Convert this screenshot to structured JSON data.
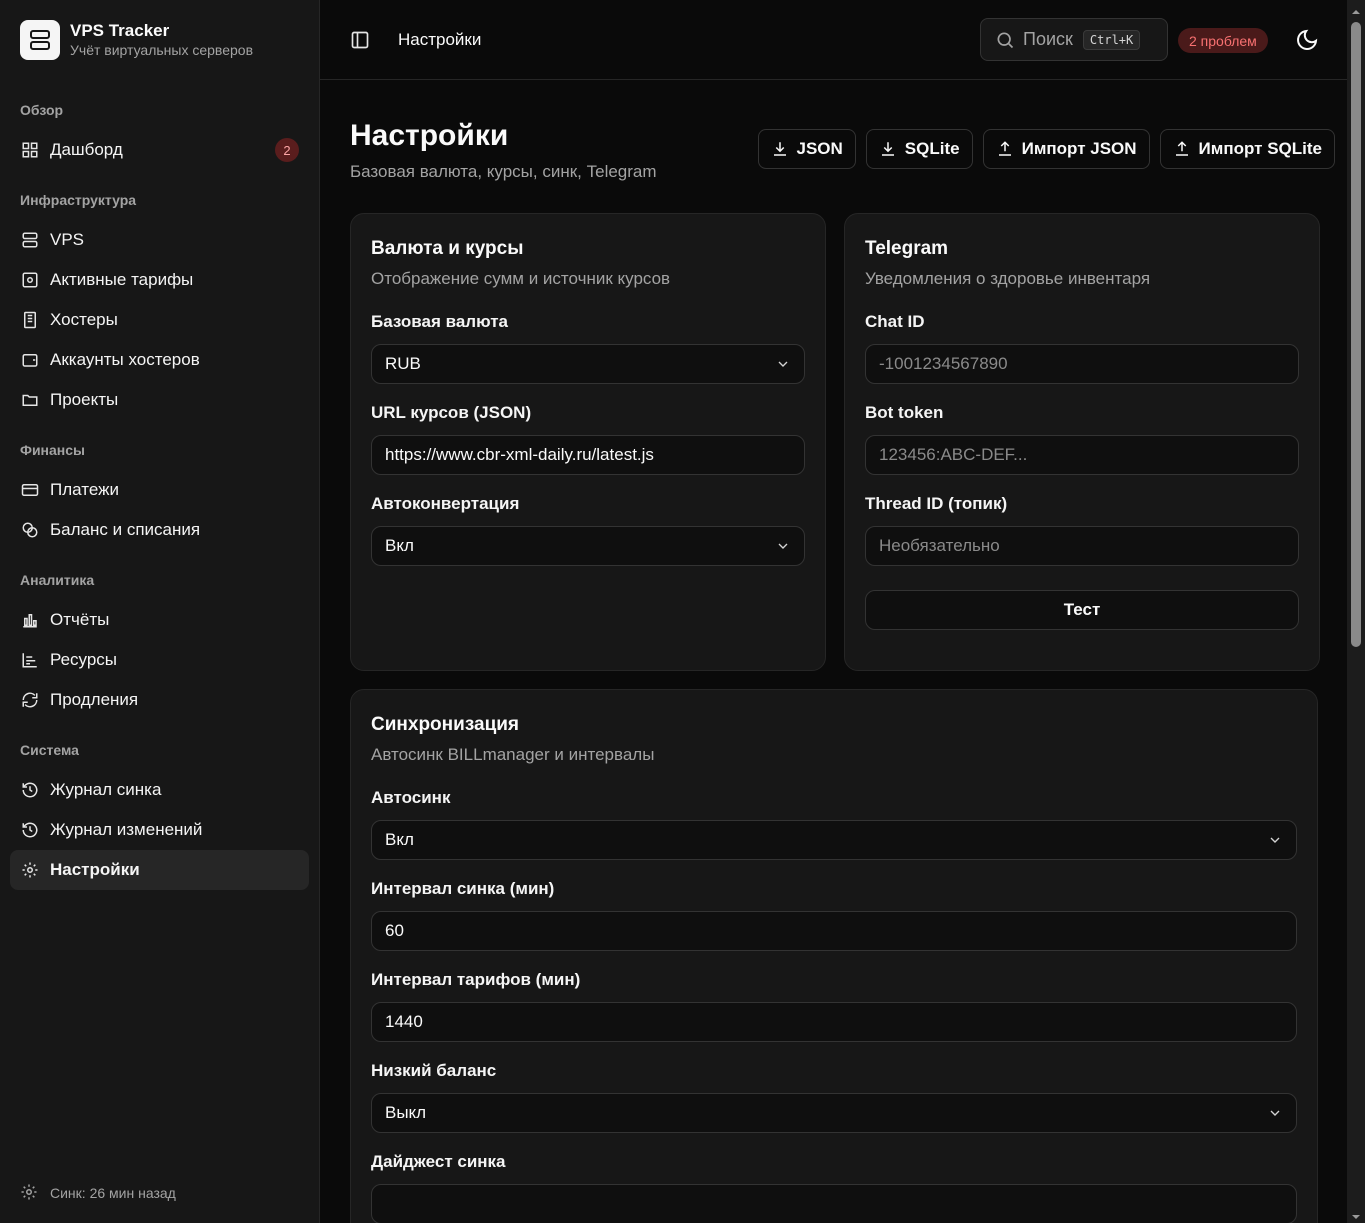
{
  "brand": {
    "title": "VPS Tracker",
    "subtitle": "Учёт виртуальных серверов"
  },
  "sidebar": {
    "groups": [
      {
        "label": "Обзор",
        "items": [
          {
            "label": "Дашборд",
            "badge": "2"
          }
        ]
      },
      {
        "label": "Инфраструктура",
        "items": [
          {
            "label": "VPS"
          },
          {
            "label": "Активные тарифы"
          },
          {
            "label": "Хостеры"
          },
          {
            "label": "Аккаунты хостеров"
          },
          {
            "label": "Проекты"
          }
        ]
      },
      {
        "label": "Финансы",
        "items": [
          {
            "label": "Платежи"
          },
          {
            "label": "Баланс и списания"
          }
        ]
      },
      {
        "label": "Аналитика",
        "items": [
          {
            "label": "Отчёты"
          },
          {
            "label": "Ресурсы"
          },
          {
            "label": "Продления"
          }
        ]
      },
      {
        "label": "Система",
        "items": [
          {
            "label": "Журнал синка"
          },
          {
            "label": "Журнал изменений"
          },
          {
            "label": "Настройки"
          }
        ]
      }
    ],
    "footer": "Синк: 26 мин назад"
  },
  "topbar": {
    "title": "Настройки",
    "search_placeholder": "Поиск",
    "shortcut": "Ctrl+K",
    "problems": "2 проблем"
  },
  "page": {
    "title": "Настройки",
    "subtitle": "Базовая валюта, курсы, синк, Telegram",
    "buttons": {
      "json": "JSON",
      "sqlite": "SQLite",
      "import_json": "Импорт JSON",
      "import_sqlite": "Импорт SQLite"
    }
  },
  "currency_card": {
    "title": "Валюта и курсы",
    "subtitle": "Отображение сумм и источник курсов",
    "base_label": "Базовая валюта",
    "base_value": "RUB",
    "url_label": "URL курсов (JSON)",
    "url_value": "https://www.cbr-xml-daily.ru/latest.js",
    "auto_label": "Автоконвертация",
    "auto_value": "Вкл"
  },
  "telegram_card": {
    "title": "Telegram",
    "subtitle": "Уведомления о здоровье инвентаря",
    "chat_label": "Chat ID",
    "chat_placeholder": "-1001234567890",
    "token_label": "Bot token",
    "token_placeholder": "123456:ABC-DEF...",
    "thread_label": "Thread ID (топик)",
    "thread_placeholder": "Необязательно",
    "test_label": "Тест"
  },
  "sync_card": {
    "title": "Синхронизация",
    "subtitle": "Автосинк BILLmanager и интервалы",
    "autosync_label": "Автосинк",
    "autosync_value": "Вкл",
    "interval_label": "Интервал синка (мин)",
    "interval_value": "60",
    "tariff_label": "Интервал тарифов (мин)",
    "tariff_value": "1440",
    "lowbal_label": "Низкий баланс",
    "lowbal_value": "Выкл",
    "digest_label": "Дайджест синка"
  }
}
